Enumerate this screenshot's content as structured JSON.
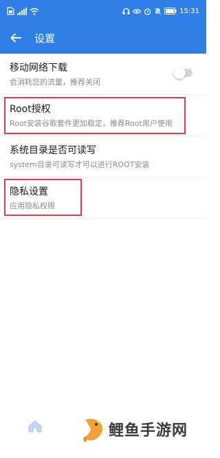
{
  "status_bar": {
    "left_icons": [
      "sim-card-icon",
      "signal-icon",
      "wifi-icon"
    ],
    "right_icons": [
      "headphones-icon",
      "eye-icon",
      "alarm-icon",
      "mute-icon",
      "battery-icon"
    ],
    "time": "15:31"
  },
  "app_bar": {
    "back_icon": "arrow-left-icon",
    "title": "设置"
  },
  "settings": [
    {
      "title": "移动网络下载",
      "subtitle": "会消耗您的流量，推荐关闭",
      "toggle": false
    },
    {
      "title": "Root授权",
      "subtitle": "Root安装谷歌套件更加稳定，推荐Root用户使用"
    },
    {
      "title": "系统目录是否可读写",
      "subtitle": "system目录可读写才可以进行ROOT安装"
    },
    {
      "title": "隐私设置",
      "subtitle": "应用隐私权限"
    }
  ],
  "bottom_nav": {
    "home_icon": "home-icon"
  },
  "watermark": {
    "text": "鲤鱼手游网"
  },
  "colors": {
    "accent": "#2f7fe6",
    "highlight": "#e53950"
  }
}
